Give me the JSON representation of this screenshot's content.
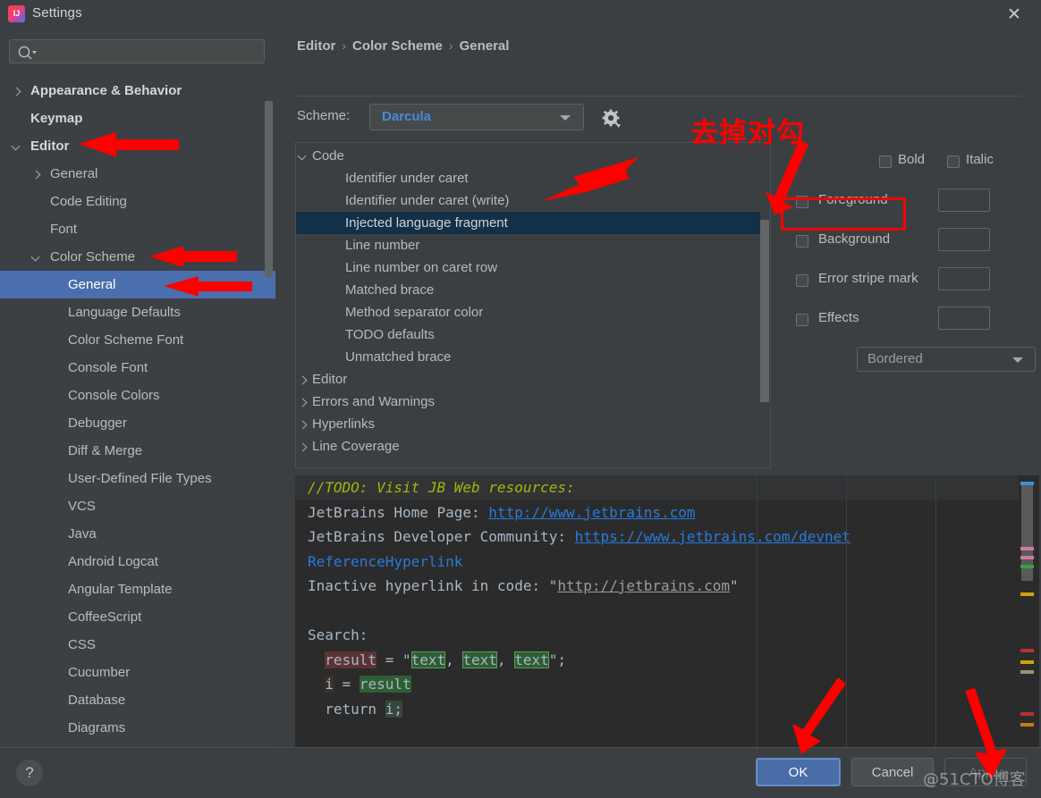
{
  "window": {
    "title": "Settings",
    "icon": "intellij-idea-icon",
    "close_label": "✕"
  },
  "sidebar": {
    "search": {
      "placeholder": "",
      "value": "",
      "icon": "search-icon"
    },
    "items": [
      {
        "label": "Appearance & Behavior",
        "indent": 34,
        "arrow": "right",
        "bold": true,
        "selected": false
      },
      {
        "label": "Keymap",
        "indent": 34,
        "arrow": "none",
        "bold": true,
        "selected": false
      },
      {
        "label": "Editor",
        "indent": 34,
        "arrow": "down",
        "bold": true,
        "selected": false
      },
      {
        "label": "General",
        "indent": 56,
        "arrow": "right",
        "bold": false,
        "selected": false
      },
      {
        "label": "Code Editing",
        "indent": 56,
        "arrow": "none",
        "bold": false,
        "selected": false
      },
      {
        "label": "Font",
        "indent": 56,
        "arrow": "none",
        "bold": false,
        "selected": false
      },
      {
        "label": "Color Scheme",
        "indent": 56,
        "arrow": "down",
        "bold": false,
        "selected": false
      },
      {
        "label": "General",
        "indent": 76,
        "arrow": "none",
        "bold": false,
        "selected": true
      },
      {
        "label": "Language Defaults",
        "indent": 76,
        "arrow": "none",
        "bold": false,
        "selected": false
      },
      {
        "label": "Color Scheme Font",
        "indent": 76,
        "arrow": "none",
        "bold": false,
        "selected": false
      },
      {
        "label": "Console Font",
        "indent": 76,
        "arrow": "none",
        "bold": false,
        "selected": false
      },
      {
        "label": "Console Colors",
        "indent": 76,
        "arrow": "none",
        "bold": false,
        "selected": false
      },
      {
        "label": "Debugger",
        "indent": 76,
        "arrow": "none",
        "bold": false,
        "selected": false
      },
      {
        "label": "Diff & Merge",
        "indent": 76,
        "arrow": "none",
        "bold": false,
        "selected": false
      },
      {
        "label": "User-Defined File Types",
        "indent": 76,
        "arrow": "none",
        "bold": false,
        "selected": false
      },
      {
        "label": "VCS",
        "indent": 76,
        "arrow": "none",
        "bold": false,
        "selected": false
      },
      {
        "label": "Java",
        "indent": 76,
        "arrow": "none",
        "bold": false,
        "selected": false
      },
      {
        "label": "Android Logcat",
        "indent": 76,
        "arrow": "none",
        "bold": false,
        "selected": false
      },
      {
        "label": "Angular Template",
        "indent": 76,
        "arrow": "none",
        "bold": false,
        "selected": false
      },
      {
        "label": "CoffeeScript",
        "indent": 76,
        "arrow": "none",
        "bold": false,
        "selected": false
      },
      {
        "label": "CSS",
        "indent": 76,
        "arrow": "none",
        "bold": false,
        "selected": false
      },
      {
        "label": "Cucumber",
        "indent": 76,
        "arrow": "none",
        "bold": false,
        "selected": false
      },
      {
        "label": "Database",
        "indent": 76,
        "arrow": "none",
        "bold": false,
        "selected": false
      },
      {
        "label": "Diagrams",
        "indent": 76,
        "arrow": "none",
        "bold": false,
        "selected": false
      }
    ]
  },
  "main": {
    "breadcrumb": [
      "Editor",
      "Color Scheme",
      "General"
    ],
    "breadcrumb_separator": "›",
    "scheme": {
      "label": "Scheme:",
      "value": "Darcula",
      "gear_icon": "gear-icon",
      "dropdown_icon": "chevron-down-icon"
    },
    "tree": [
      {
        "label": "Code",
        "indent": 18,
        "arrow": "down",
        "selected": false
      },
      {
        "label": "Identifier under caret",
        "indent": 55,
        "arrow": "none",
        "selected": false
      },
      {
        "label": "Identifier under caret (write)",
        "indent": 55,
        "arrow": "none",
        "selected": false
      },
      {
        "label": "Injected language fragment",
        "indent": 55,
        "arrow": "none",
        "selected": true
      },
      {
        "label": "Line number",
        "indent": 55,
        "arrow": "none",
        "selected": false
      },
      {
        "label": "Line number on caret row",
        "indent": 55,
        "arrow": "none",
        "selected": false
      },
      {
        "label": "Matched brace",
        "indent": 55,
        "arrow": "none",
        "selected": false
      },
      {
        "label": "Method separator color",
        "indent": 55,
        "arrow": "none",
        "selected": false
      },
      {
        "label": "TODO defaults",
        "indent": 55,
        "arrow": "none",
        "selected": false
      },
      {
        "label": "Unmatched brace",
        "indent": 55,
        "arrow": "none",
        "selected": false
      },
      {
        "label": "Editor",
        "indent": 18,
        "arrow": "right",
        "selected": false
      },
      {
        "label": "Errors and Warnings",
        "indent": 18,
        "arrow": "right",
        "selected": false
      },
      {
        "label": "Hyperlinks",
        "indent": 18,
        "arrow": "right",
        "selected": false
      },
      {
        "label": "Line Coverage",
        "indent": 18,
        "arrow": "right",
        "selected": false
      }
    ],
    "attributes": {
      "bold": {
        "label": "Bold",
        "checked": false
      },
      "italic": {
        "label": "Italic",
        "checked": false
      },
      "rows": [
        {
          "label": "Foreground",
          "checked": false
        },
        {
          "label": "Background",
          "checked": false
        },
        {
          "label": "Error stripe mark",
          "checked": false
        },
        {
          "label": "Effects",
          "checked": false
        }
      ],
      "effects_type": "Bordered"
    },
    "preview": {
      "line1": "//TODO: Visit JB Web resources:",
      "line2_text": "JetBrains Home Page: ",
      "line2_url": "http://www.jetbrains.com",
      "line3_text": "JetBrains Developer Community: ",
      "line3_url": "https://www.jetbrains.com/devnet",
      "line4": "ReferenceHyperlink",
      "line5_text": "Inactive hyperlink in code: ",
      "line5_url": "http://jetbrains.com",
      "line6": "",
      "line7": "Search:",
      "line8_a": "result",
      "line8_b": " = \"",
      "line8_c": "text",
      "line8_d": ", ",
      "line8_e": "text",
      "line8_f": ", ",
      "line8_g": "text",
      "line8_h": "\";",
      "line9_a": "i",
      "line9_b": " = ",
      "line9_c": "result",
      "line10_a": "return ",
      "line10_b": "i;"
    }
  },
  "bottom": {
    "help_label": "?",
    "ok_label": "OK",
    "cancel_label": "Cancel",
    "apply_label": "Apply"
  },
  "annotations": {
    "note_text": "去掉对勾",
    "highlight_color": "#ff0000",
    "watermark": "@51CTO博客"
  }
}
